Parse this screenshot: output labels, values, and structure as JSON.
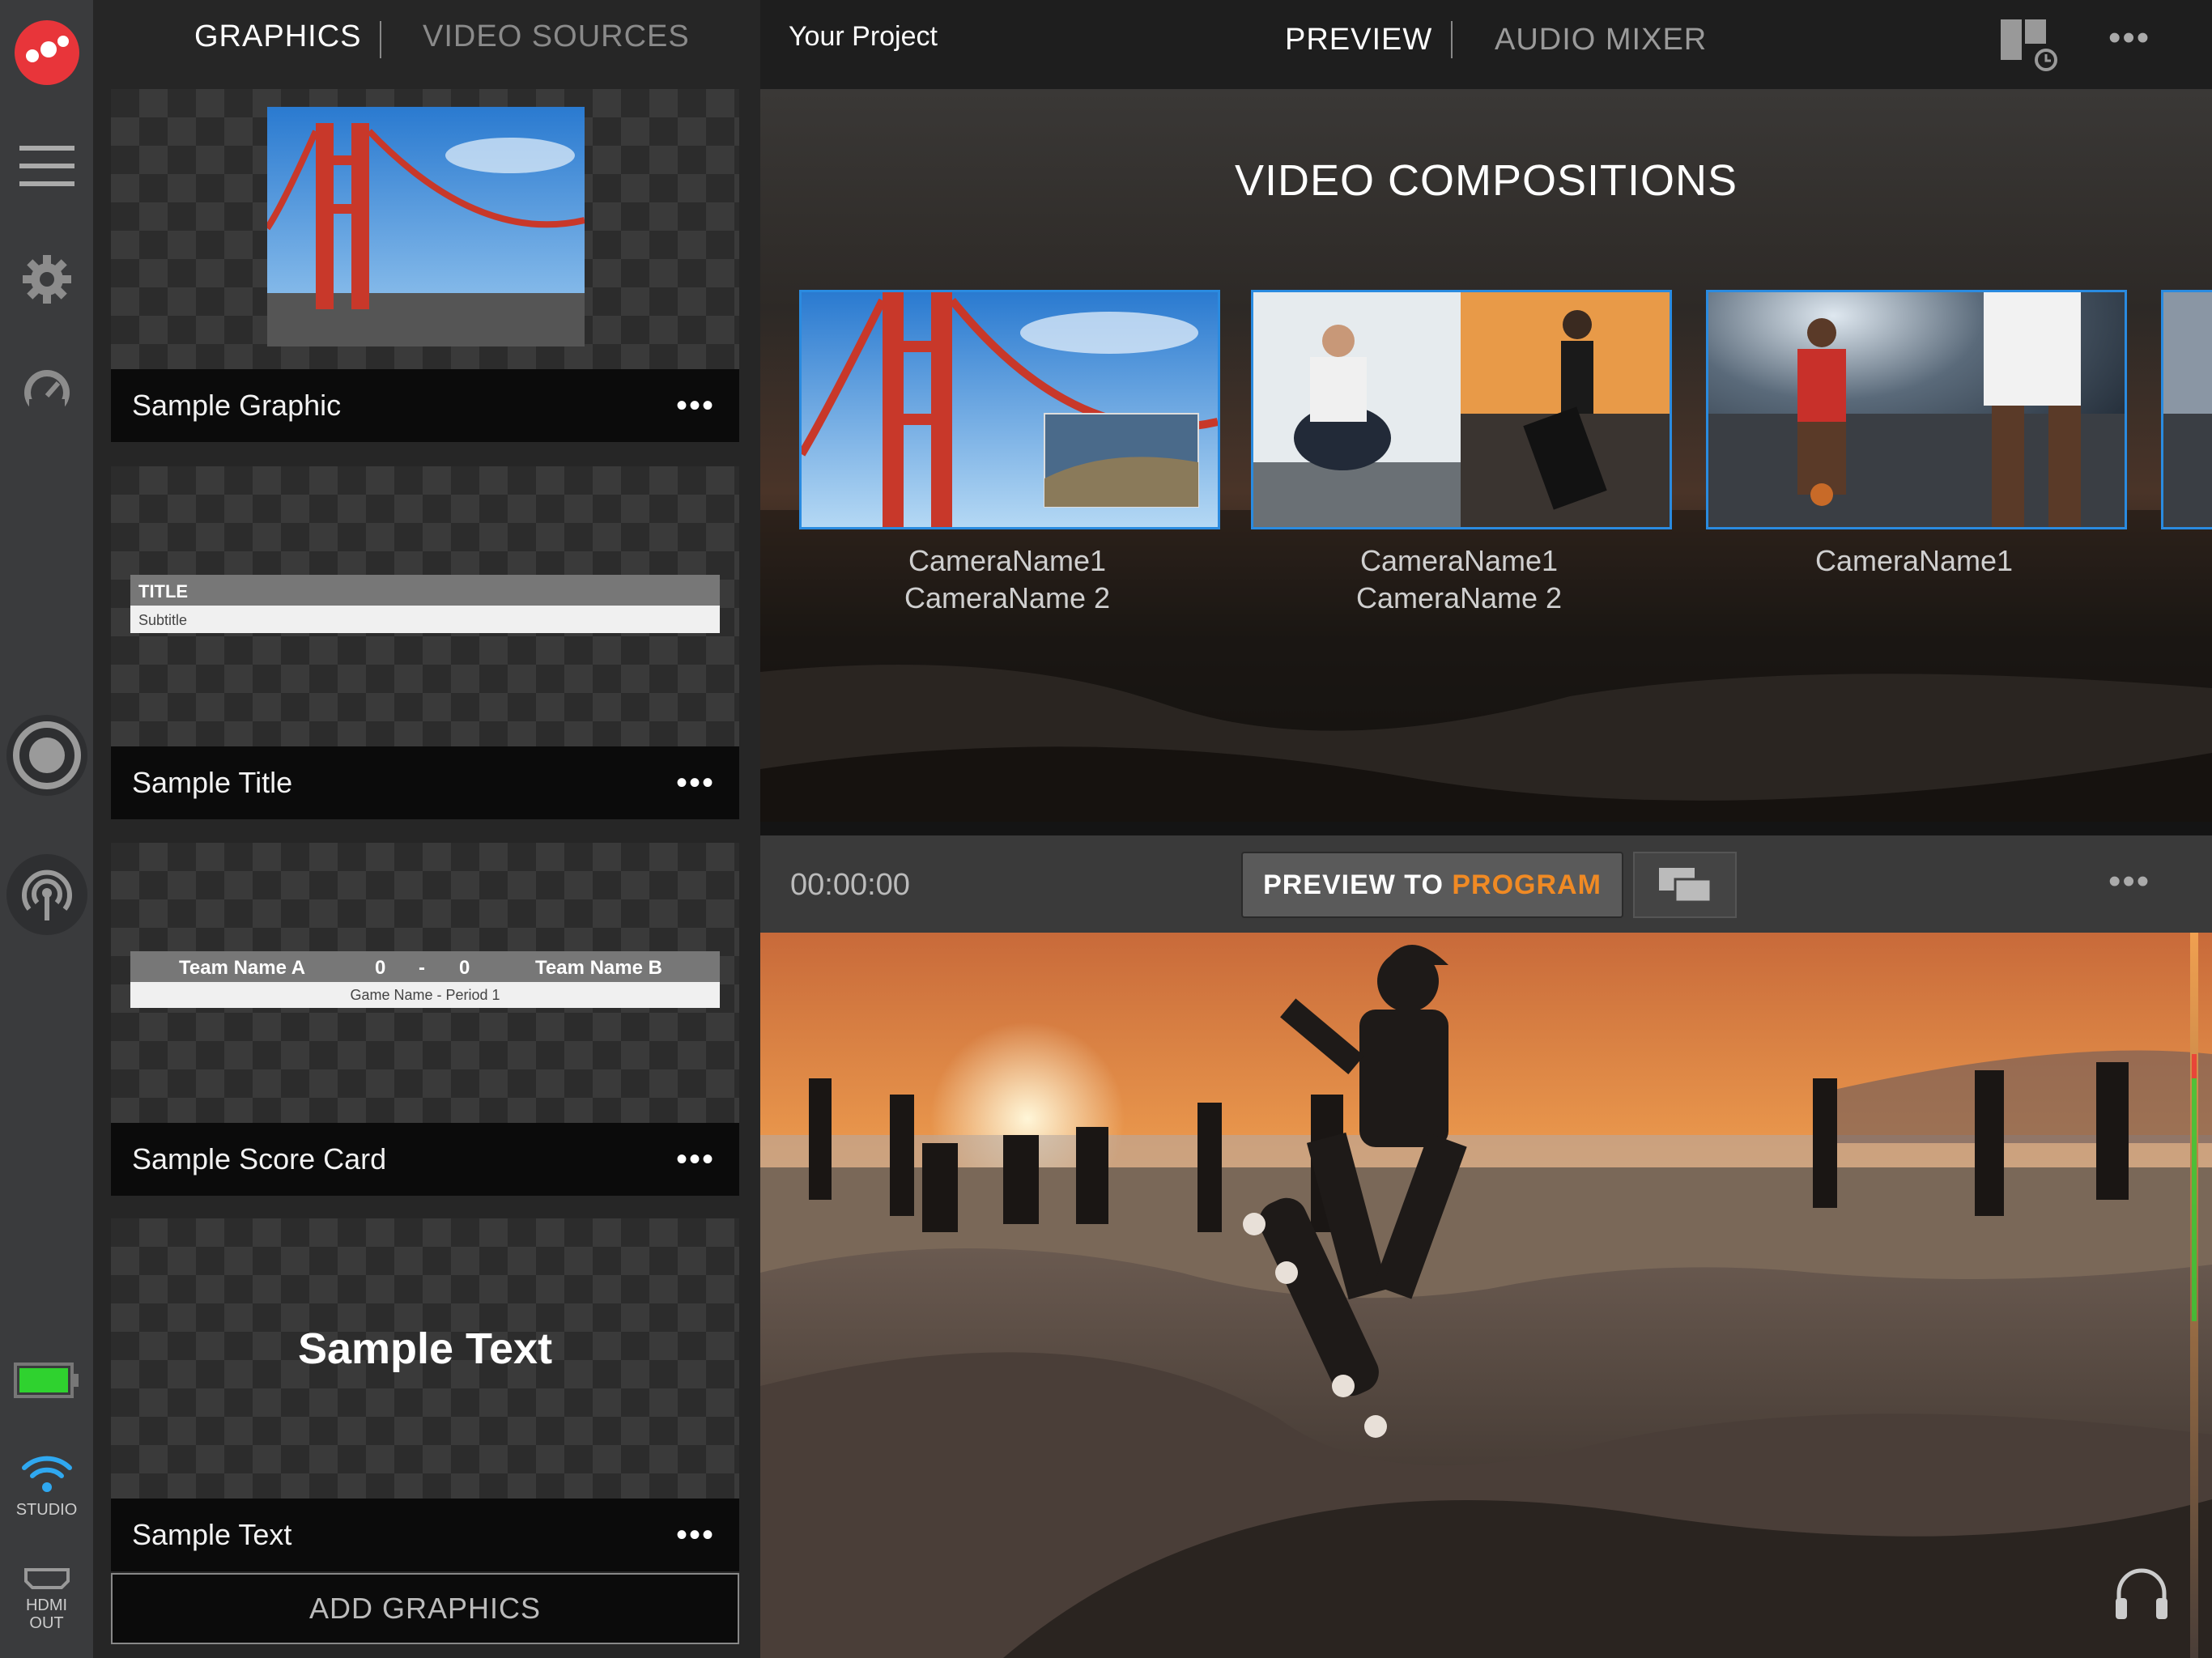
{
  "colors": {
    "accent_red": "#e8353a",
    "program_orange": "#f08a24",
    "selection_blue": "#2a8be0",
    "battery_green": "#2fd22f",
    "wifi_blue": "#2fa8f0"
  },
  "rail": {
    "icons": [
      "app-logo-icon",
      "hamburger-menu-icon",
      "gear-icon",
      "gauge-icon",
      "record-icon",
      "broadcast-icon",
      "battery-icon",
      "wifi-icon",
      "hdmi-icon"
    ],
    "studio_label": "STUDIO",
    "hdmi_label": "HDMI\nOUT",
    "battery_level": 1.0
  },
  "graphics_panel": {
    "tabs": [
      {
        "label": "GRAPHICS",
        "active": true
      },
      {
        "label": "VIDEO SOURCES",
        "active": false
      }
    ],
    "cards": [
      {
        "label": "Sample Graphic",
        "more": "•••"
      },
      {
        "label": "Sample Title",
        "more": "•••",
        "overlay_title": "TITLE",
        "overlay_subtitle": "Subtitle"
      },
      {
        "label": "Sample Score Card",
        "more": "•••",
        "team_a": "Team Name A",
        "score_a": "0",
        "dash": "-",
        "score_b": "0",
        "team_b": "Team Name B",
        "game": "Game Name - Period 1"
      },
      {
        "label": "Sample Text",
        "more": "•••",
        "overlay_text": "Sample Text"
      }
    ],
    "add_button": "ADD GRAPHICS"
  },
  "topbar": {
    "project": "Your Project",
    "tabs": [
      {
        "label": "PREVIEW",
        "active": true
      },
      {
        "label": "AUDIO MIXER",
        "active": false
      }
    ],
    "layout_icon": "layout-clock-icon",
    "more": "•••"
  },
  "compositions": {
    "title": "VIDEO COMPOSITIONS",
    "items": [
      {
        "cam1": "CameraName1",
        "cam2": "CameraName 2"
      },
      {
        "cam1": "CameraName1",
        "cam2": "CameraName 2"
      },
      {
        "cam1": "CameraName1",
        "cam2": ""
      }
    ]
  },
  "preview": {
    "timecode": "00:00:00",
    "btn_prefix": "PREVIEW TO ",
    "btn_program": "PROGRAM",
    "more": "•••",
    "headphones_icon": "headphones-icon",
    "screens_icon": "screens-icon"
  }
}
